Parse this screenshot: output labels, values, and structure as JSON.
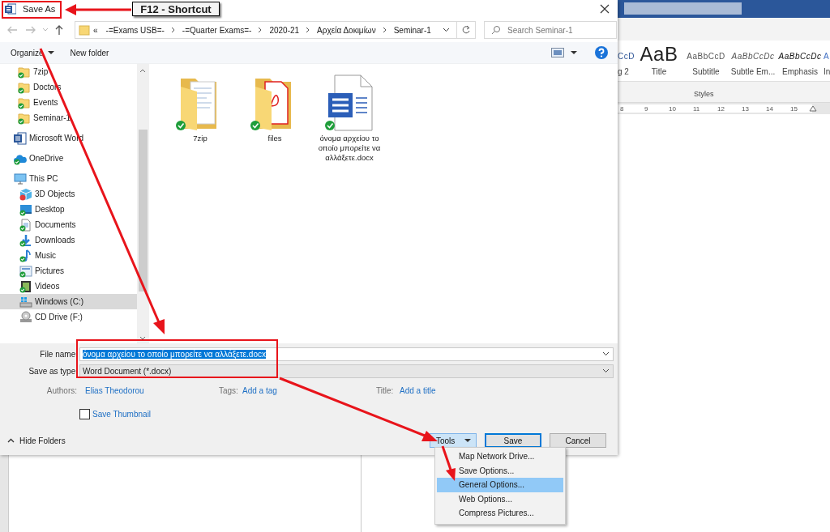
{
  "word": {
    "styles": [
      {
        "preview": "CcD",
        "label": "g 2",
        "kind": "heading"
      },
      {
        "preview": "AaB",
        "label": "Title",
        "kind": "title"
      },
      {
        "preview": "AaBbCcD",
        "label": "Subtitle",
        "kind": "subtitle"
      },
      {
        "preview": "AaBbCcDc",
        "label": "Subtle Em...",
        "kind": "subtle"
      },
      {
        "preview": "AaBbCcDc",
        "label": "Emphasis",
        "kind": "emphasis"
      },
      {
        "preview": "A",
        "label": "In",
        "kind": "intense"
      }
    ],
    "styles_group": "Styles",
    "ruler": [
      "8",
      "9",
      "10",
      "11",
      "12",
      "13",
      "14",
      "15"
    ]
  },
  "window": {
    "title": "Save As"
  },
  "address": {
    "overflow": "«",
    "crumbs": [
      "-=Exams USB=-",
      "-=Quarter Exams=-",
      "2020-21",
      "Αρχεία Δοκιμίων",
      "Seminar-1"
    ],
    "search_placeholder": "Search Seminar-1"
  },
  "toolbar": {
    "organize": "Organize",
    "new_folder": "New folder"
  },
  "sidebar": {
    "pinned": [
      {
        "label": "7zip",
        "kind": "folder",
        "selected": false
      },
      {
        "label": "Doctors",
        "kind": "folder",
        "selected": false
      },
      {
        "label": "Events",
        "kind": "folder",
        "selected": false
      },
      {
        "label": "Seminar-1",
        "kind": "folder",
        "selected": false
      }
    ],
    "items": [
      {
        "label": "Microsoft Word",
        "kind": "word",
        "selected": false
      },
      {
        "label": "OneDrive",
        "kind": "cloud",
        "selected": false
      },
      {
        "label": "This PC",
        "kind": "pc",
        "selected": false,
        "children": [
          {
            "label": "3D Objects",
            "kind": "cube",
            "selected": false
          },
          {
            "label": "Desktop",
            "kind": "desktop",
            "selected": false
          },
          {
            "label": "Documents",
            "kind": "documents",
            "selected": false
          },
          {
            "label": "Downloads",
            "kind": "downloads",
            "selected": false
          },
          {
            "label": "Music",
            "kind": "music",
            "selected": false
          },
          {
            "label": "Pictures",
            "kind": "pictures",
            "selected": false
          },
          {
            "label": "Videos",
            "kind": "videos",
            "selected": false
          },
          {
            "label": "Windows (C:)",
            "kind": "drive",
            "selected": true
          },
          {
            "label": "CD Drive (F:)",
            "kind": "disc",
            "selected": false
          }
        ]
      }
    ]
  },
  "files": [
    {
      "name": "7zip",
      "kind": "folder-docs"
    },
    {
      "name": "files",
      "kind": "folder-pdf"
    },
    {
      "name": "όνομα αρχείου το οποίο μπορείτε να αλλάξετε.docx",
      "kind": "word-doc"
    }
  ],
  "form": {
    "file_name": {
      "label": "File name:",
      "value": "όνομα αρχείου το οποίο μπορείτε να αλλάξετε.docx",
      "highlighted": true
    },
    "save_as_type": {
      "label": "Save as type:",
      "value": "Word Document (*.docx)"
    },
    "authors": {
      "label": "Authors:",
      "value": "Elias Theodorou"
    },
    "tags": {
      "label": "Tags:",
      "value": "Add a tag"
    },
    "title": {
      "label": "Title:",
      "value": "Add a title"
    },
    "save_thumbnail": {
      "label": "Save Thumbnail",
      "checked": false
    },
    "hide_folders": "Hide Folders"
  },
  "buttons": [
    {
      "label": "Tools",
      "kind": "dropdown",
      "pressed": true,
      "default": false
    },
    {
      "label": "Save",
      "kind": "plain",
      "pressed": false,
      "default": true
    },
    {
      "label": "Cancel",
      "kind": "plain",
      "pressed": false,
      "default": false
    }
  ],
  "menu": {
    "items": [
      {
        "label": "Map Network Drive...",
        "selected": false
      },
      {
        "label": "Save Options...",
        "selected": false
      },
      {
        "label": "General Options...",
        "selected": true
      },
      {
        "label": "Web Options...",
        "selected": false
      },
      {
        "label": "Compress Pictures...",
        "selected": false
      }
    ]
  },
  "annotation": {
    "label": "F12 - Shortcut"
  }
}
